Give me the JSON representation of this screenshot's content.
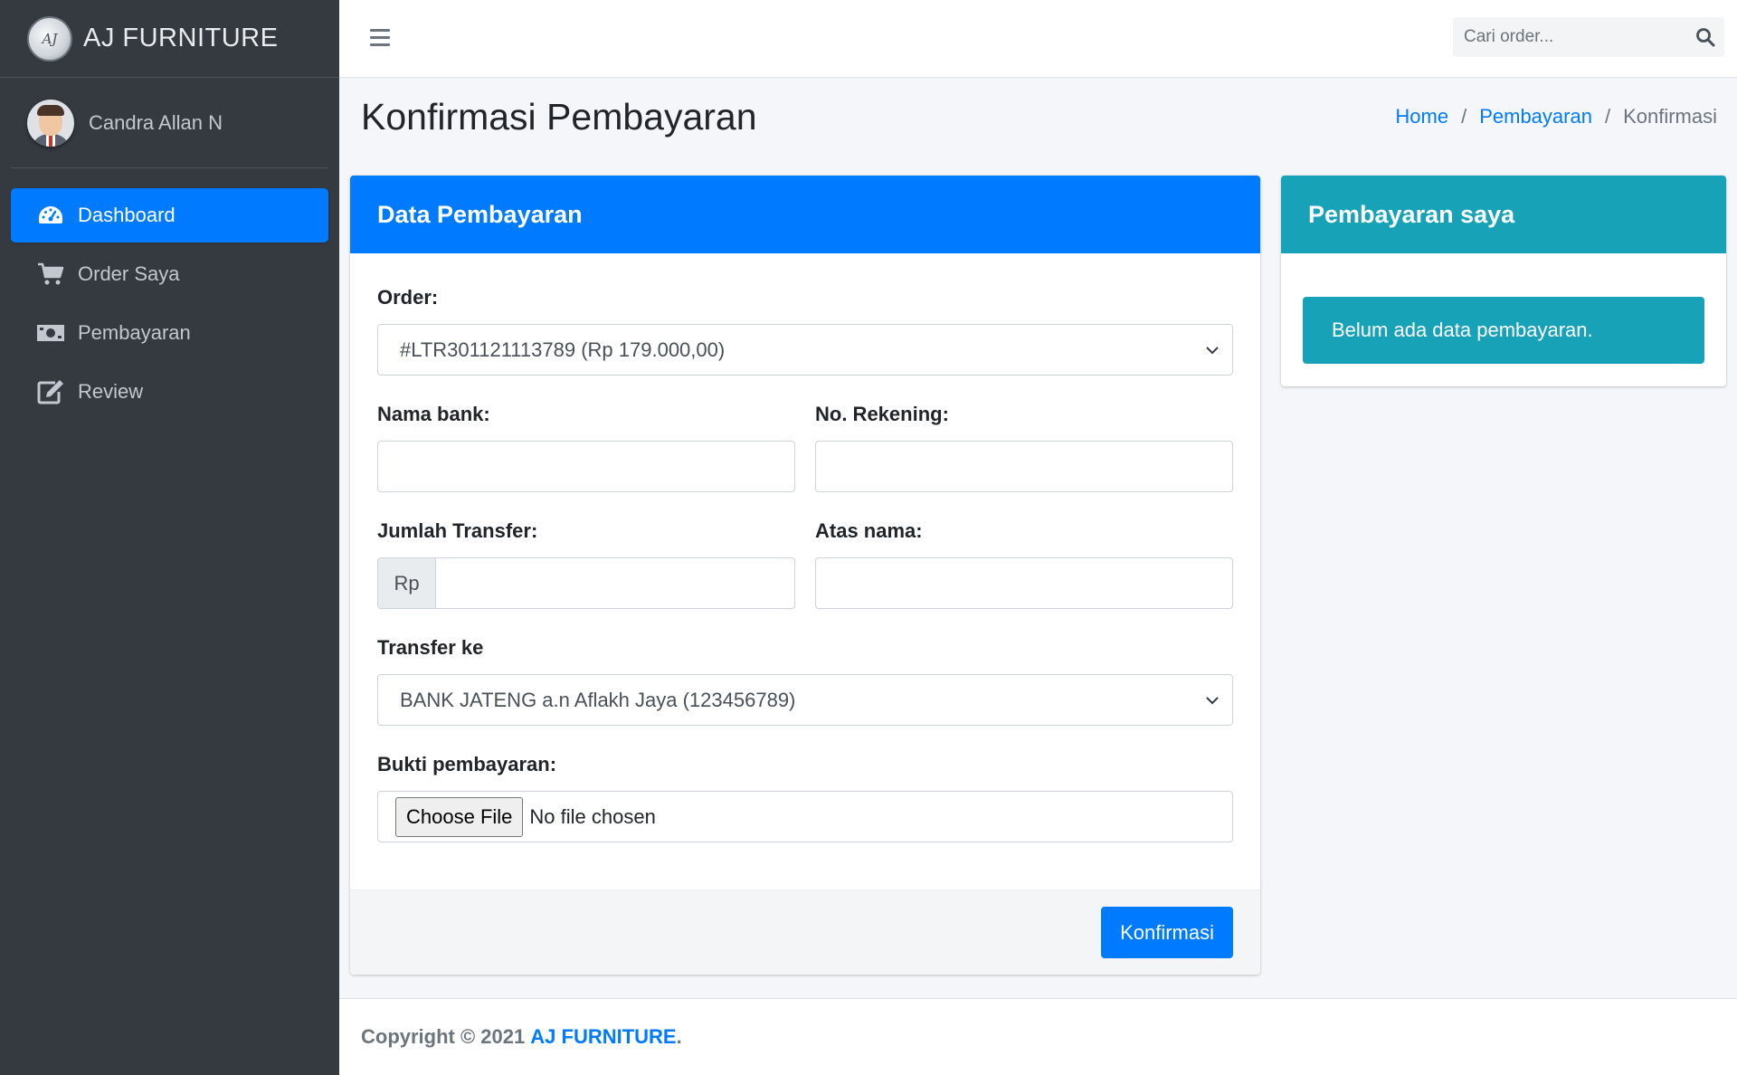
{
  "brand": {
    "logo_text": "AJ",
    "name": "AJ FURNITURE"
  },
  "user": {
    "name": "Candra Allan N"
  },
  "sidebar": {
    "items": [
      {
        "label": "Dashboard",
        "icon": "tachometer-icon",
        "active": true
      },
      {
        "label": "Order Saya",
        "icon": "cart-icon",
        "active": false
      },
      {
        "label": "Pembayaran",
        "icon": "money-bill-icon",
        "active": false
      },
      {
        "label": "Review",
        "icon": "edit-icon",
        "active": false
      }
    ]
  },
  "topbar": {
    "search_placeholder": "Cari order..."
  },
  "page": {
    "title": "Konfirmasi Pembayaran",
    "breadcrumb": {
      "home": "Home",
      "section": "Pembayaran",
      "current": "Konfirmasi",
      "separator": "/"
    }
  },
  "form": {
    "header": "Data Pembayaran",
    "order_label": "Order:",
    "order_value": "#LTR301121113789 (Rp 179.000,00)",
    "bank_label": "Nama bank:",
    "bank_value": "",
    "rekening_label": "No. Rekening:",
    "rekening_value": "",
    "jumlah_label": "Jumlah Transfer:",
    "jumlah_prefix": "Rp",
    "jumlah_value": "",
    "atas_nama_label": "Atas nama:",
    "atas_nama_value": "",
    "transfer_label": "Transfer ke",
    "transfer_value": "BANK JATENG a.n Aflakh Jaya (123456789)",
    "bukti_label": "Bukti pembayaran:",
    "file_button": "Choose File",
    "file_status": "No file chosen",
    "submit_label": "Konfirmasi"
  },
  "payments": {
    "header": "Pembayaran saya",
    "empty_message": "Belum ada data pembayaran."
  },
  "footer": {
    "prefix": "Copyright © 2021",
    "brand": "AJ FURNITURE",
    "suffix": "."
  },
  "colors": {
    "primary": "#007bff",
    "info": "#17a2b8",
    "sidebar": "#343a40",
    "background": "#f4f6f9"
  }
}
